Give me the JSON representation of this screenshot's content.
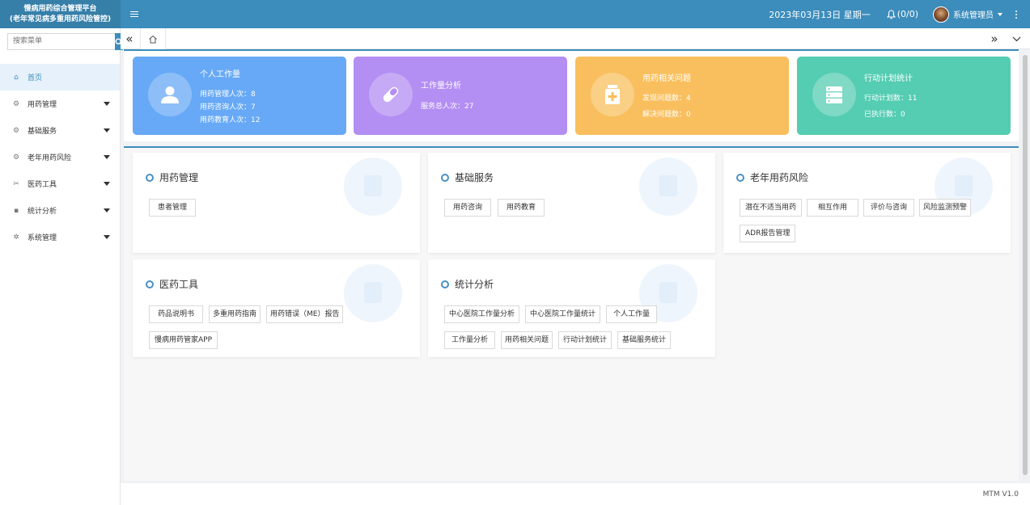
{
  "app": {
    "title_line1": "慢病用药综合管理平台",
    "title_line2": "(老年常见病多重用药风险管控)"
  },
  "header": {
    "date": "2023年03月13日 星期一",
    "notifications": "(0/0)",
    "user_name": "系统管理员"
  },
  "sidebar": {
    "search_placeholder": "搜索菜单",
    "items": [
      {
        "label": "首页",
        "icon": "home-icon"
      },
      {
        "label": "用药管理",
        "icon": "gear-icon"
      },
      {
        "label": "基础服务",
        "icon": "gear-icon"
      },
      {
        "label": "老年用药风险",
        "icon": "gear-icon"
      },
      {
        "label": "医药工具",
        "icon": "tools-icon"
      },
      {
        "label": "统计分析",
        "icon": "monitor-icon"
      },
      {
        "label": "系统管理",
        "icon": "settings-icon"
      }
    ]
  },
  "stats": [
    {
      "title": "个人工作量",
      "color": "#67a9f6",
      "icon": "user-icon",
      "lines": [
        "用药管理人次：8",
        "用药咨询人次：7",
        "用药教育人次：12"
      ]
    },
    {
      "title": "工作量分析",
      "color": "#b38ef3",
      "icon": "pill-icon",
      "lines": [
        "服务总人次：27"
      ]
    },
    {
      "title": "用药相关问题",
      "color": "#f9bf5e",
      "icon": "medicine-bottle-icon",
      "lines": [
        "发现问题数：4",
        "解决问题数：0"
      ]
    },
    {
      "title": "行动计划统计",
      "color": "#54cdb2",
      "icon": "server-icon",
      "lines": [
        "行动计划数：11",
        "已执行数：0"
      ]
    }
  ],
  "modules": [
    {
      "title": "用药管理",
      "buttons": [
        "患者管理"
      ]
    },
    {
      "title": "基础服务",
      "buttons": [
        "用药咨询",
        "用药教育"
      ]
    },
    {
      "title": "老年用药风险",
      "buttons": [
        "潜在不适当用药",
        "相互作用",
        "评价与咨询",
        "风险监测预警",
        "ADR报告管理"
      ]
    },
    {
      "title": "医药工具",
      "buttons": [
        "药品说明书",
        "多重用药指南",
        "用药错误（ME）报告",
        "慢病用药管家APP"
      ]
    },
    {
      "title": "统计分析",
      "buttons": [
        "中心医院工作量分析",
        "中心医院工作量统计",
        "个人工作量",
        "工作量分析",
        "用药相关问题",
        "行动计划统计",
        "基础服务统计"
      ]
    }
  ],
  "footer": {
    "version": "MTM V1.0"
  }
}
